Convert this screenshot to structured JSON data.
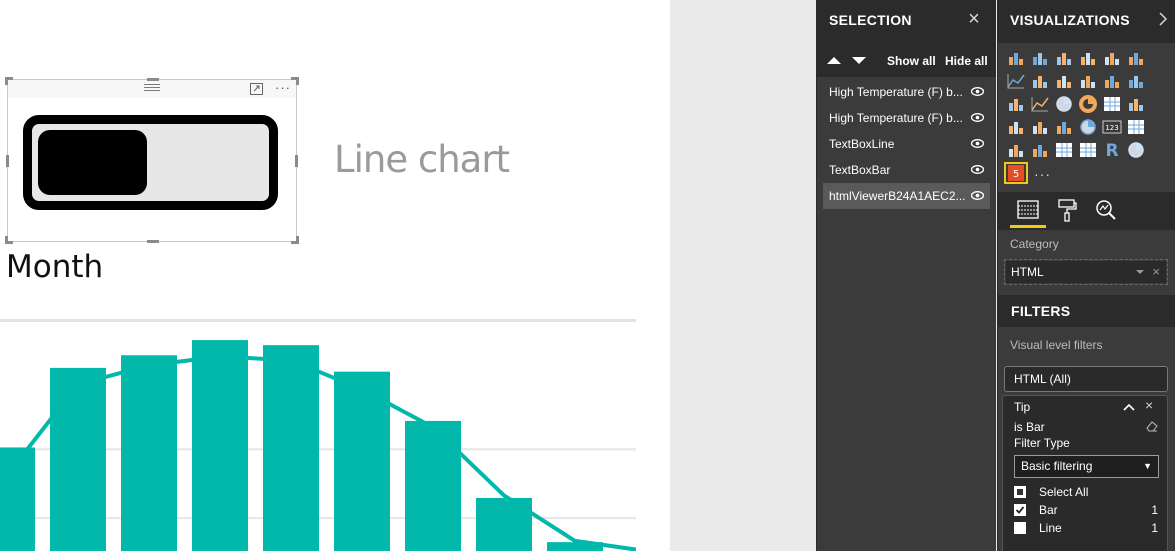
{
  "canvas": {
    "line_chart_label": "Line chart",
    "month_label": "Month",
    "toggle_visual": {
      "more_glyph": "···",
      "toggle_state": "on"
    }
  },
  "chart_data": {
    "type": "bar",
    "categories": [
      "",
      "",
      "",
      "",
      "",
      "",
      "",
      "",
      "",
      "",
      ""
    ],
    "values": [
      82,
      145,
      155,
      167,
      163,
      142,
      103,
      42,
      7,
      0,
      0
    ],
    "line_values": [
      60,
      132,
      147,
      154,
      151,
      128,
      98,
      44,
      8,
      0,
      0
    ],
    "ylim": [
      0,
      175
    ],
    "bar_color": "#01b8aa",
    "line_color": "#01b8aa",
    "gridlines_y": [
      20,
      62
    ]
  },
  "selection_pane": {
    "title": "SELECTION",
    "show_all": "Show all",
    "hide_all": "Hide all",
    "items": [
      {
        "label": "High Temperature (F) b...",
        "visible": true
      },
      {
        "label": "High Temperature (F) b...",
        "visible": true
      },
      {
        "label": "TextBoxLine",
        "visible": true
      },
      {
        "label": "TextBoxBar",
        "visible": true
      },
      {
        "label": "htmlViewerB24A1AEC2...",
        "visible": true
      }
    ]
  },
  "viz_pane": {
    "title": "VISUALIZATIONS",
    "more_glyph": "···",
    "icons": [
      "stacked-bar-icon",
      "stacked-column-icon",
      "clustered-bar-icon",
      "clustered-column-icon",
      "100-bar-icon",
      "100-column-icon",
      "line-chart-icon",
      "area-chart-icon",
      "stacked-area-icon",
      "line-column-icon",
      "line-clustered-column-icon",
      "ribbon-chart-icon",
      "waterfall-icon",
      "scatter-icon",
      "pie-icon",
      "donut-icon",
      "treemap-icon",
      "map-icon",
      "filled-map-icon",
      "shape-map-icon",
      "funnel-icon",
      "gauge-icon",
      "card-icon",
      "multi-row-card-icon",
      "kpi-icon",
      "slicer-icon",
      "table-icon",
      "matrix-icon",
      "r-visual-icon",
      "globe-icon",
      "html-viewer-icon"
    ],
    "category_label": "Category",
    "category_value": "HTML",
    "filters_title": "FILTERS",
    "visual_level_filters": "Visual level filters",
    "html_filter": "HTML  (All)",
    "tip_card": {
      "title": "Tip",
      "subtitle": "is Bar",
      "filter_type_label": "Filter Type",
      "filter_type_value": "Basic filtering",
      "options": [
        {
          "label": "Select All",
          "count": "",
          "state": "partial"
        },
        {
          "label": "Bar",
          "count": "1",
          "state": "checked"
        },
        {
          "label": "Line",
          "count": "1",
          "state": "unchecked"
        }
      ]
    }
  }
}
